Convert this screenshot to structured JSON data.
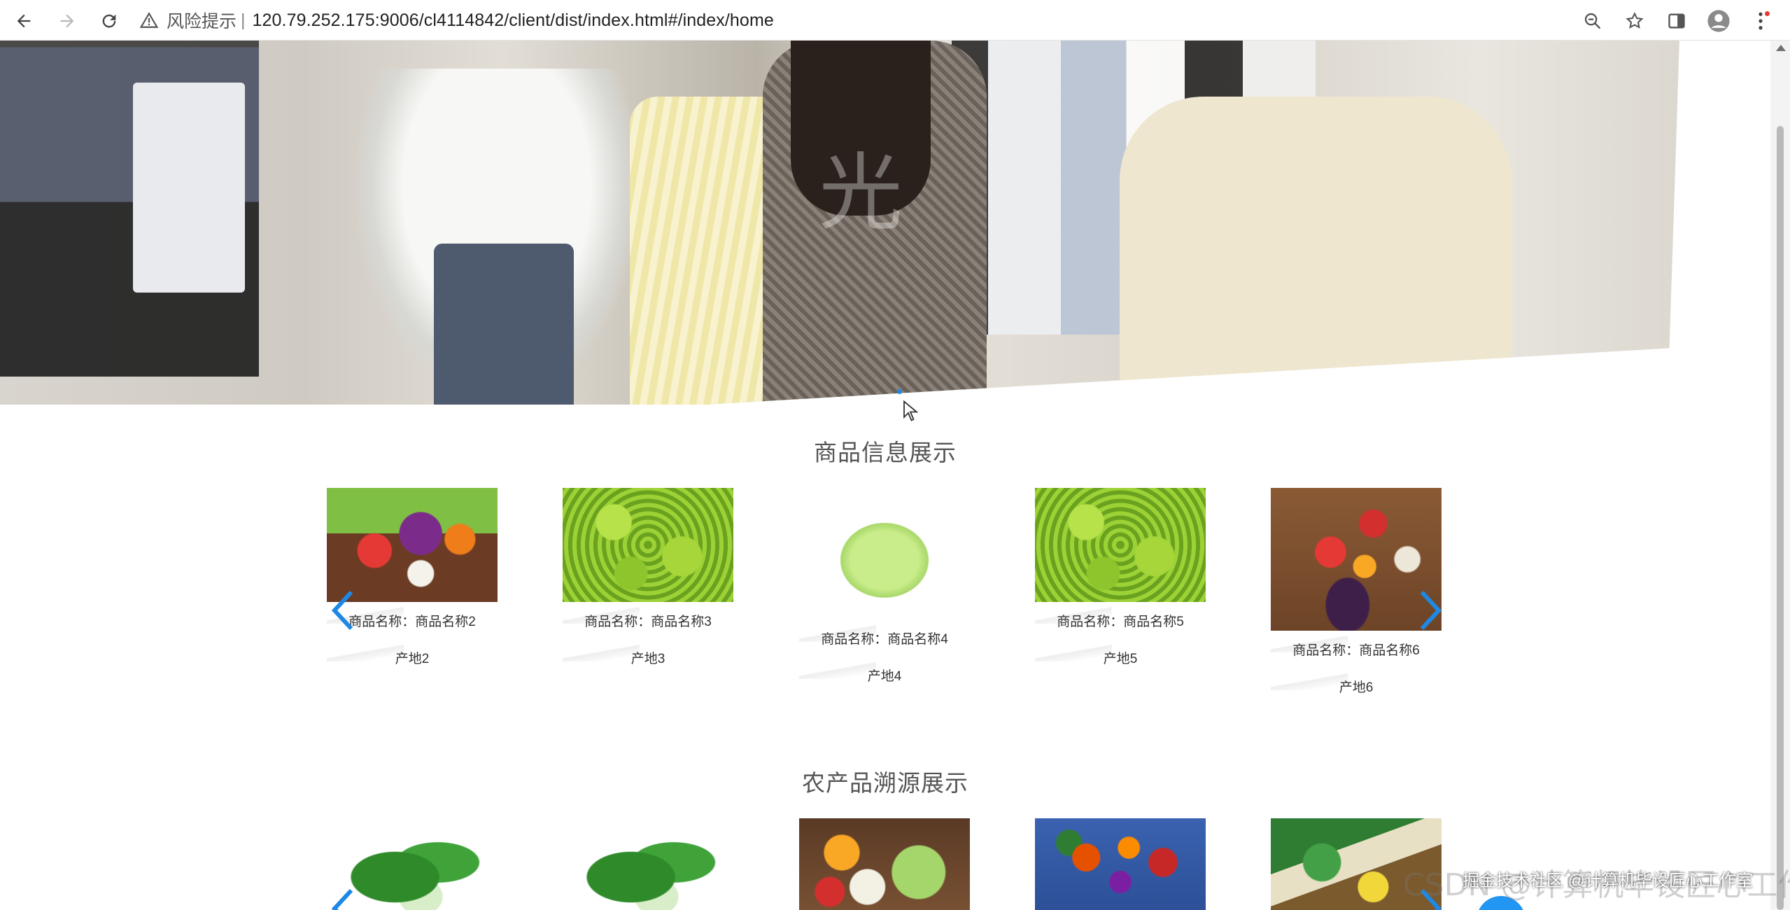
{
  "browser": {
    "security_label": "风险提示",
    "separator": "|",
    "url": "120.79.252.175:9006/cl4114842/client/dist/index.html#/index/home",
    "icons": [
      "back-icon",
      "forward-icon",
      "reload-icon",
      "warning-icon",
      "zoom-out-icon",
      "bookmark-star-icon",
      "side-panel-icon",
      "profile-icon",
      "menu-kebab-icon"
    ]
  },
  "banner": {
    "overlay_text": "光"
  },
  "products": {
    "title": "商品信息展示",
    "items": [
      {
        "name": "商品名称：商品名称2",
        "origin": "产地2"
      },
      {
        "name": "商品名称：商品名称3",
        "origin": "产地3"
      },
      {
        "name": "商品名称：商品名称4",
        "origin": "产地4"
      },
      {
        "name": "商品名称：商品名称5",
        "origin": "产地5"
      },
      {
        "name": "商品名称：商品名称6",
        "origin": "产地6"
      }
    ]
  },
  "trace": {
    "title": "农产品溯源展示"
  },
  "watermark": {
    "text_back": "CSDN @计算机毕设匠心工作室",
    "text_front": "掘金技术社区 @计算机毕设匠心工作室"
  },
  "colors": {
    "accent": "#1e88e5",
    "title": "#555555",
    "float_button": "#2196f3"
  }
}
